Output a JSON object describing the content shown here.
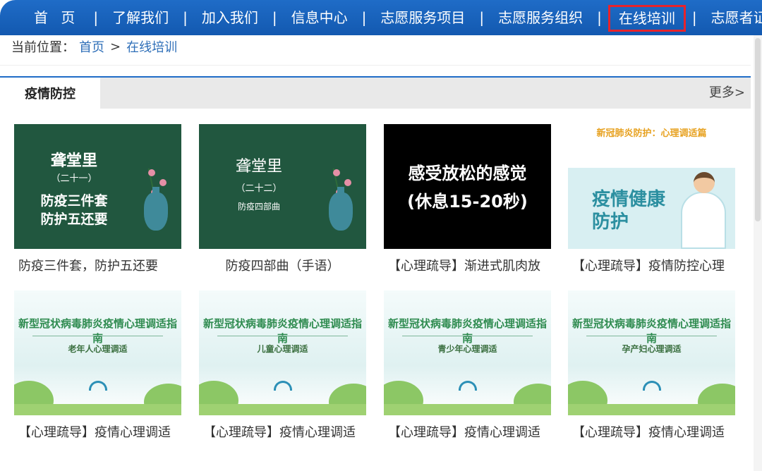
{
  "nav": {
    "items": [
      {
        "label": "首 页"
      },
      {
        "label": "了解我们"
      },
      {
        "label": "加入我们"
      },
      {
        "label": "信息中心"
      },
      {
        "label": "志愿服务项目"
      },
      {
        "label": "志愿服务组织"
      },
      {
        "label": "在线培训",
        "active": true
      },
      {
        "label": "志愿者证(?"
      }
    ],
    "separator": "|"
  },
  "breadcrumb": {
    "prefix": "当前位置：",
    "home": "首页",
    "arrow": ">",
    "current": "在线培训"
  },
  "section": {
    "tab": "疫情防控",
    "more": "更多>"
  },
  "cards": [
    {
      "caption": "防疫三件套，防护五还要",
      "thumb": {
        "kind": "green",
        "title": "聋堂里",
        "sub": "（二十一）",
        "line1": "防疫三件套",
        "line2": "防护五还要"
      }
    },
    {
      "caption": "防疫四部曲（手语）",
      "thumb": {
        "kind": "green",
        "title": "聋堂里",
        "sub": "（二十二）",
        "line1": "防疫四部曲"
      }
    },
    {
      "caption": "【心理疏导】渐进式肌肉放",
      "thumb": {
        "kind": "black",
        "line1": "感受放松的感觉",
        "line2": "(休息15-20秒)"
      }
    },
    {
      "caption": "【心理疏导】疫情防控心理",
      "thumb": {
        "kind": "health",
        "banner": "新冠肺炎防护：心理调适篇",
        "line1": "疫情健康",
        "line2": "防护"
      }
    },
    {
      "caption": "【心理疏导】疫情心理调适",
      "thumb": {
        "kind": "guide",
        "title": "新型冠状病毒肺炎疫情心理调适指南",
        "sub": "老年人心理调适"
      }
    },
    {
      "caption": "【心理疏导】疫情心理调适",
      "thumb": {
        "kind": "guide",
        "title": "新型冠状病毒肺炎疫情心理调适指南",
        "sub": "儿童心理调适"
      }
    },
    {
      "caption": "【心理疏导】疫情心理调适",
      "thumb": {
        "kind": "guide",
        "title": "新型冠状病毒肺炎疫情心理调适指南",
        "sub": "青少年心理调适"
      }
    },
    {
      "caption": "【心理疏导】疫情心理调适",
      "thumb": {
        "kind": "guide",
        "title": "新型冠状病毒肺炎疫情心理调适指南",
        "sub": "孕产妇心理调适"
      }
    }
  ],
  "colors": {
    "nav_blue": "#1f6cc7",
    "active_outline": "#e8232b",
    "link_blue": "#2f6fb8",
    "thumb_green": "#21573f"
  }
}
